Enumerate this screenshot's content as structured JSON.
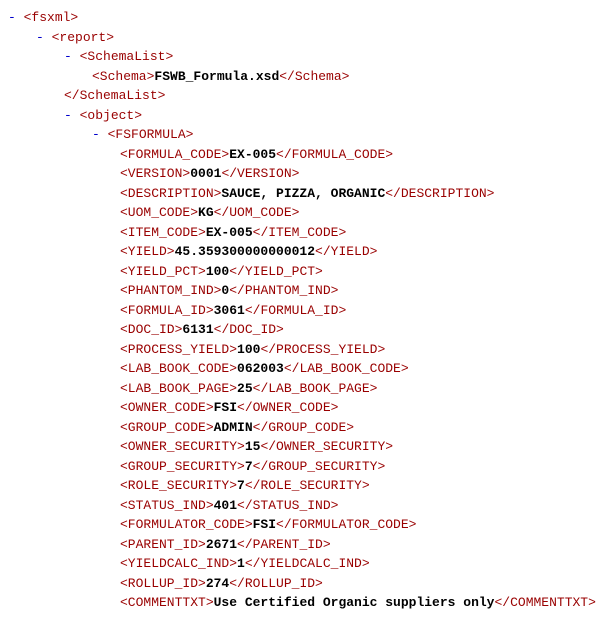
{
  "toggle": "-",
  "root": {
    "open": "<fsxml>"
  },
  "report": {
    "open": "<report>"
  },
  "schemalist": {
    "open": "<SchemaList>",
    "close": "</SchemaList>"
  },
  "schema": {
    "open": "<Schema>",
    "val": "FSWB_Formula.xsd",
    "close": "</Schema>"
  },
  "object": {
    "open": "<object>"
  },
  "fsformula": {
    "open": "<FSFORMULA>"
  },
  "fields": [
    {
      "open": "<FORMULA_CODE>",
      "val": "EX-005",
      "close": "</FORMULA_CODE>"
    },
    {
      "open": "<VERSION>",
      "val": "0001",
      "close": "</VERSION>"
    },
    {
      "open": "<DESCRIPTION>",
      "val": "SAUCE, PIZZA, ORGANIC",
      "close": "</DESCRIPTION>"
    },
    {
      "open": "<UOM_CODE>",
      "val": "KG",
      "close": "</UOM_CODE>"
    },
    {
      "open": "<ITEM_CODE>",
      "val": "EX-005",
      "close": "</ITEM_CODE>"
    },
    {
      "open": "<YIELD>",
      "val": "45.359300000000012",
      "close": "</YIELD>"
    },
    {
      "open": "<YIELD_PCT>",
      "val": "100",
      "close": "</YIELD_PCT>"
    },
    {
      "open": "<PHANTOM_IND>",
      "val": "0",
      "close": "</PHANTOM_IND>"
    },
    {
      "open": "<FORMULA_ID>",
      "val": "3061",
      "close": "</FORMULA_ID>"
    },
    {
      "open": "<DOC_ID>",
      "val": "6131",
      "close": "</DOC_ID>"
    },
    {
      "open": "<PROCESS_YIELD>",
      "val": "100",
      "close": "</PROCESS_YIELD>"
    },
    {
      "open": "<LAB_BOOK_CODE>",
      "val": "062003",
      "close": "</LAB_BOOK_CODE>"
    },
    {
      "open": "<LAB_BOOK_PAGE>",
      "val": "25",
      "close": "</LAB_BOOK_PAGE>"
    },
    {
      "open": "<OWNER_CODE>",
      "val": "FSI",
      "close": "</OWNER_CODE>"
    },
    {
      "open": "<GROUP_CODE>",
      "val": "ADMIN",
      "close": "</GROUP_CODE>"
    },
    {
      "open": "<OWNER_SECURITY>",
      "val": "15",
      "close": "</OWNER_SECURITY>"
    },
    {
      "open": "<GROUP_SECURITY>",
      "val": "7",
      "close": "</GROUP_SECURITY>"
    },
    {
      "open": "<ROLE_SECURITY>",
      "val": "7",
      "close": "</ROLE_SECURITY>"
    },
    {
      "open": "<STATUS_IND>",
      "val": "401",
      "close": "</STATUS_IND>"
    },
    {
      "open": "<FORMULATOR_CODE>",
      "val": "FSI",
      "close": "</FORMULATOR_CODE>"
    },
    {
      "open": "<PARENT_ID>",
      "val": "2671",
      "close": "</PARENT_ID>"
    },
    {
      "open": "<YIELDCALC_IND>",
      "val": "1",
      "close": "</YIELDCALC_IND>"
    },
    {
      "open": "<ROLLUP_ID>",
      "val": "274",
      "close": "</ROLLUP_ID>"
    },
    {
      "open": "<COMMENTTXT>",
      "val": "Use Certified Organic suppliers only",
      "close": "</COMMENTTXT>"
    }
  ]
}
